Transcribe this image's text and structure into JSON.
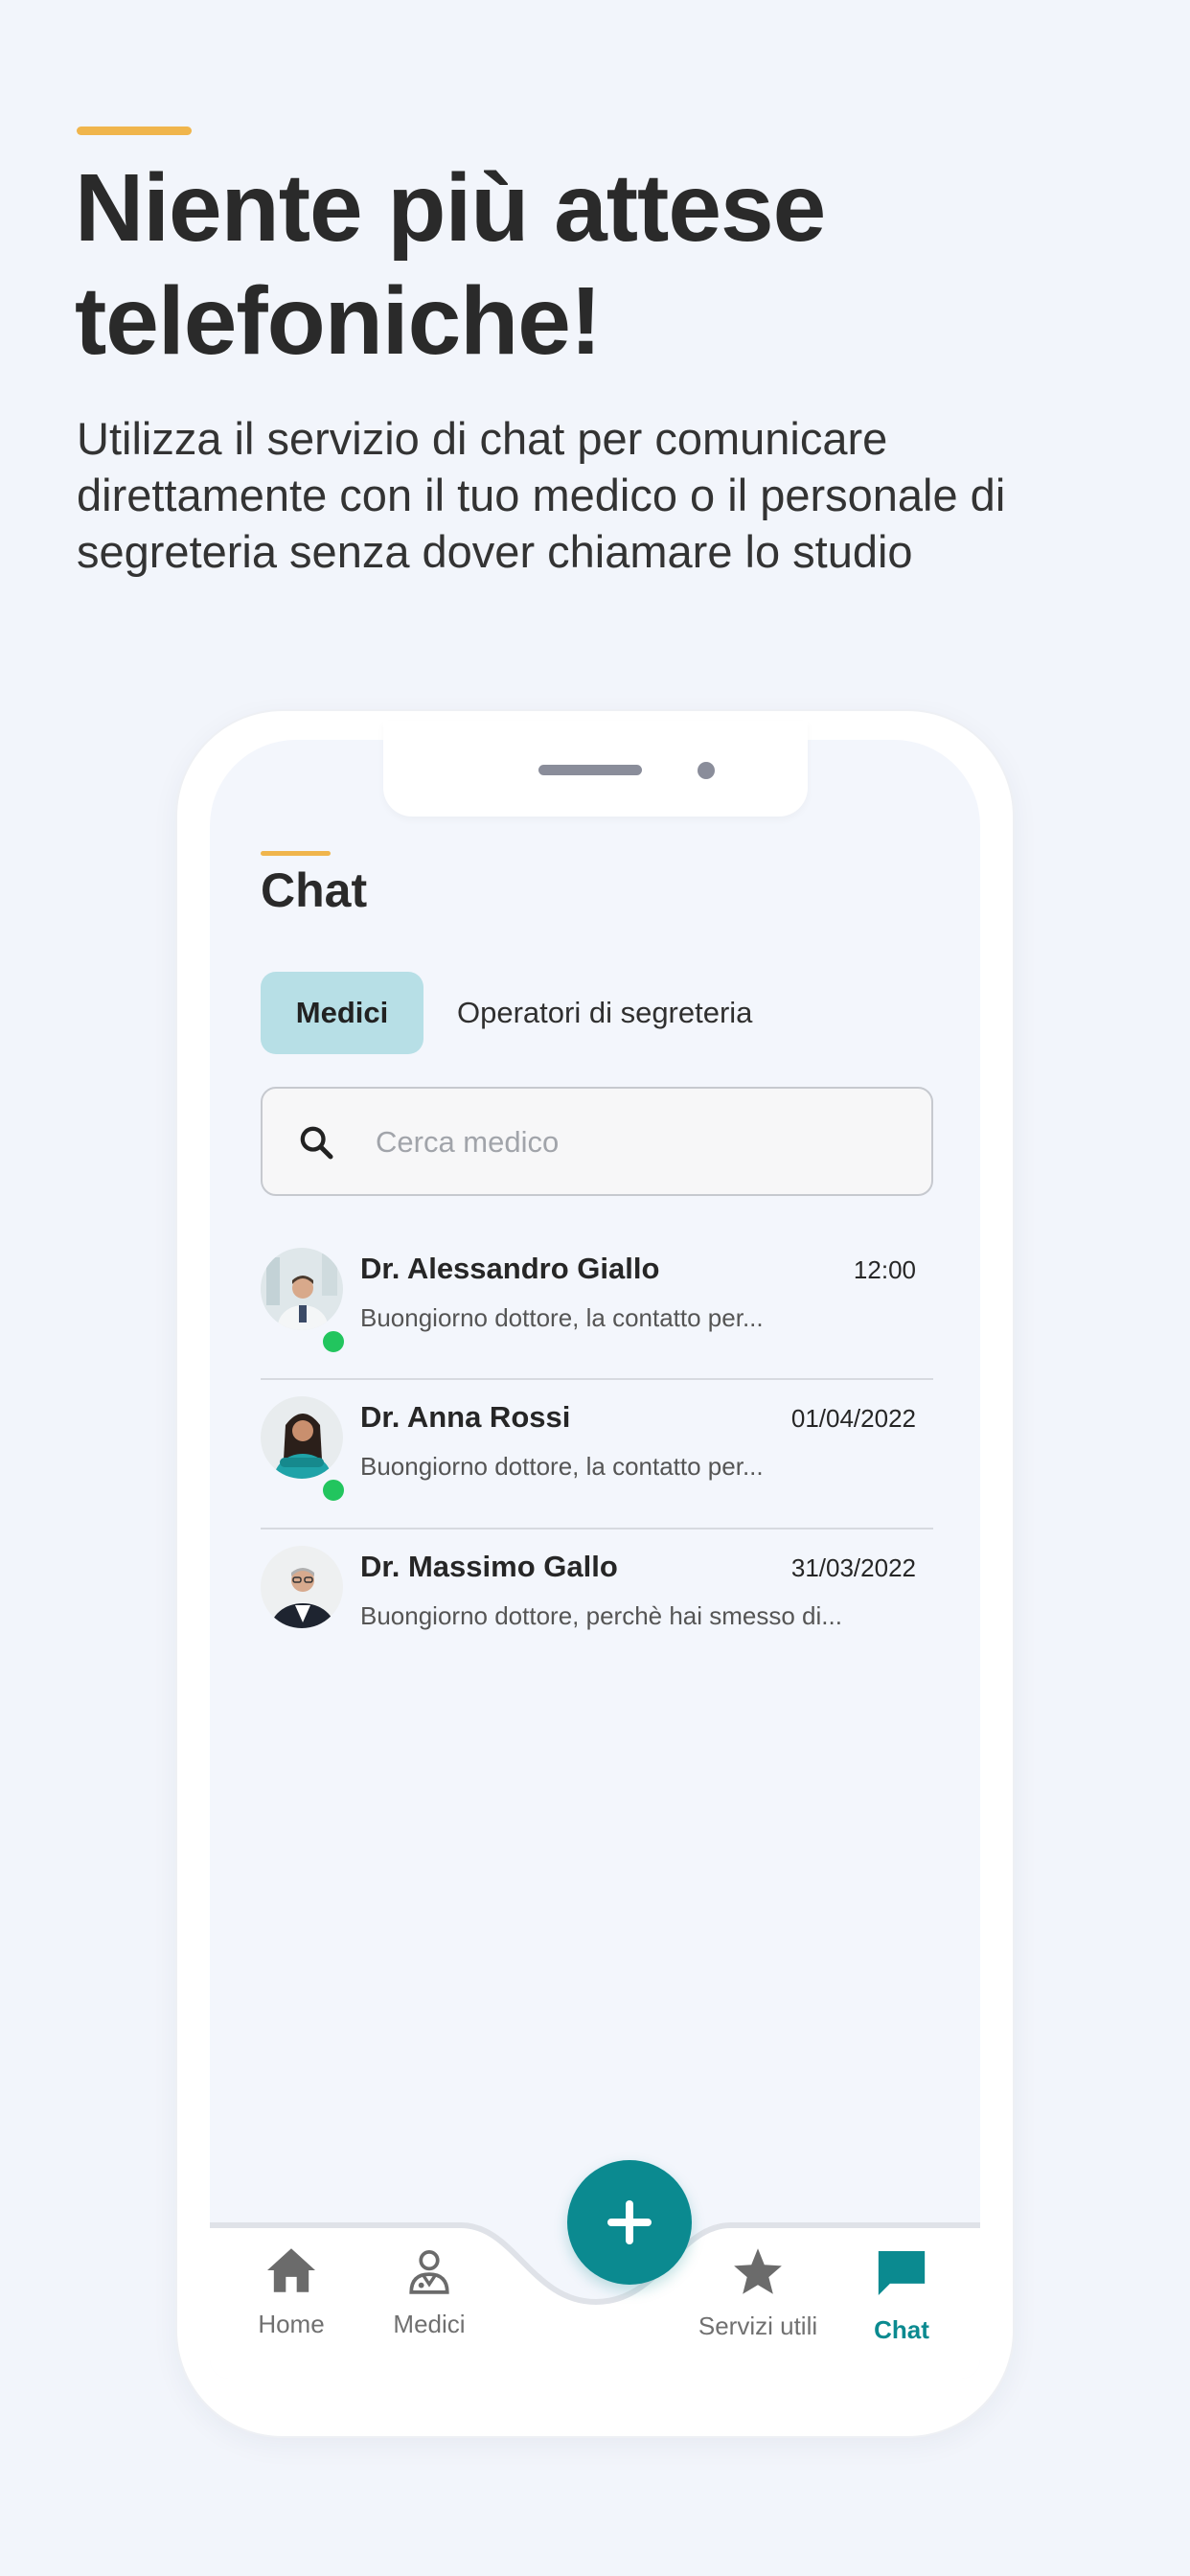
{
  "hero": {
    "title": "Niente più attese telefoniche!",
    "subtitle": "Utilizza il servizio di chat per comunicare direttamente con il tuo medico o il personale di segreteria senza dover chiamare lo studio"
  },
  "app": {
    "title": "Chat",
    "tabs": [
      {
        "label": "Medici",
        "active": true
      },
      {
        "label": "Operatori di segreteria",
        "active": false
      }
    ],
    "search": {
      "placeholder": "Cerca medico",
      "value": ""
    },
    "chats": [
      {
        "name": "Dr. Alessandro Giallo",
        "time": "12:00",
        "preview": "Buongiorno dottore, la contatto per...",
        "online": true
      },
      {
        "name": "Dr. Anna Rossi",
        "time": "01/04/2022",
        "preview": "Buongiorno dottore, la contatto per...",
        "online": true
      },
      {
        "name": "Dr. Massimo Gallo",
        "time": "31/03/2022",
        "preview": "Buongiorno dottore, perchè hai smesso di...",
        "online": false
      }
    ],
    "nav": [
      {
        "label": "Home",
        "icon": "home-icon",
        "active": false
      },
      {
        "label": "Medici",
        "icon": "doctor-icon",
        "active": false
      },
      {
        "label": "Servizi utili",
        "icon": "star-icon",
        "active": false
      },
      {
        "label": "Chat",
        "icon": "chat-bubble-icon",
        "active": true
      }
    ],
    "fab_icon": "plus-icon"
  },
  "colors": {
    "accent": "#0b8a90",
    "highlight": "#f0b54c",
    "tab_active_bg": "#b7dfe6",
    "online": "#22c55e"
  }
}
